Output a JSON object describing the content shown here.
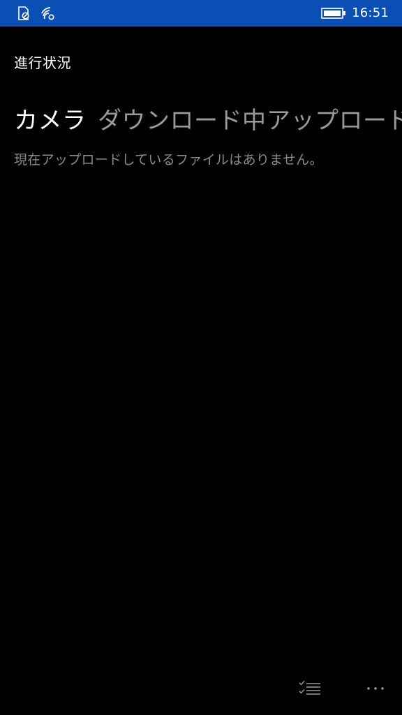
{
  "status_bar": {
    "time": "16:51",
    "icons": [
      "sim-card-icon",
      "wifi-icon",
      "battery-icon"
    ],
    "color": "#0b4fb4"
  },
  "page": {
    "title": "進行状況"
  },
  "pivot": {
    "tabs": [
      {
        "label": "カメラ",
        "active": true
      },
      {
        "label": "ダウンロード中",
        "active": false
      },
      {
        "label": "アップロード中",
        "active": false
      }
    ]
  },
  "content": {
    "empty_message": "現在アップロードしているファイルはありません。"
  },
  "app_bar": {
    "buttons": [
      "select-list-icon",
      "more-icon"
    ]
  }
}
